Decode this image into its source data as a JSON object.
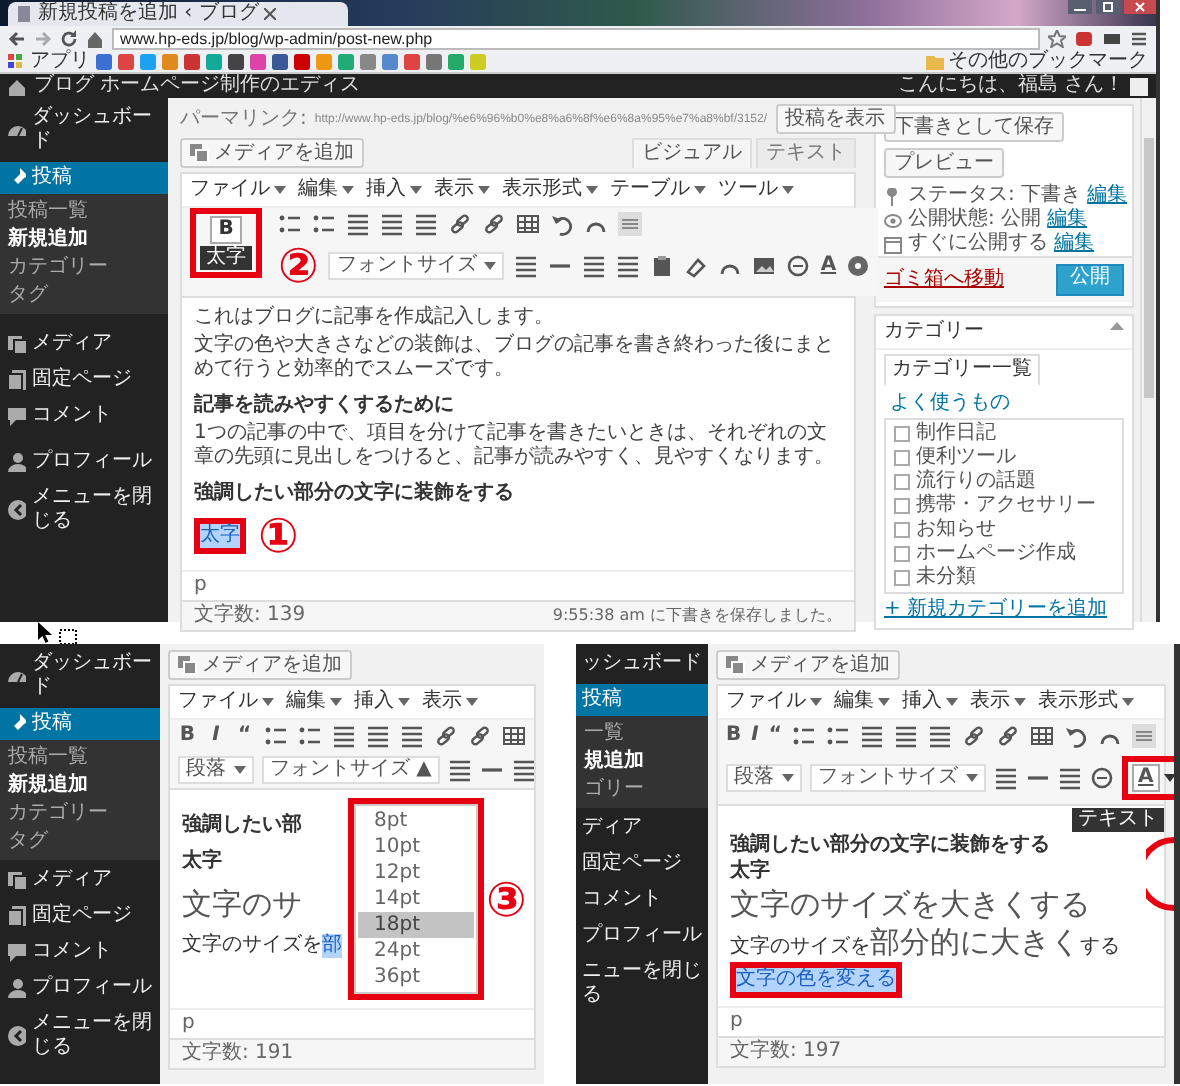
{
  "browser": {
    "tab_title": "新規投稿を追加 ‹ ブログ",
    "address": "www.hp-eds.jp/blog/wp-admin/post-new.php",
    "bookmarks": [
      "アプリ"
    ],
    "other_bookmarks": "その他のブックマーク"
  },
  "admin_bar": {
    "site_name": "ブログ ホームページ制作のエディス",
    "greeting": "こんにちは、福島 さん！"
  },
  "main_shot": {
    "sidebar": [
      {
        "label": "ダッシュボード",
        "selected": false
      },
      {
        "label": "投稿",
        "selected": true,
        "children": [
          {
            "label": "投稿一覧",
            "selected": false
          },
          {
            "label": "新規追加",
            "selected": true
          },
          {
            "label": "カテゴリー",
            "selected": false
          },
          {
            "label": "タグ",
            "selected": false
          }
        ]
      },
      {
        "label": "メディア",
        "selected": false
      },
      {
        "label": "固定ページ",
        "selected": false
      },
      {
        "label": "コメント",
        "selected": false
      },
      {
        "label": "プロフィール",
        "selected": false
      },
      {
        "label": "メニューを閉じる",
        "selected": false
      }
    ],
    "permalink": {
      "label": "パーマリンク:",
      "url": "http://www.hp-eds.jp/blog/%e6%96%b0%e8%a6%8f%e6%8a%95%e7%a8%bf/3152/",
      "button": "投稿を表示"
    },
    "media_button": "メディアを追加",
    "editor_tabs": [
      {
        "label": "ビジュアル",
        "selected": true
      },
      {
        "label": "テキスト",
        "selected": false
      }
    ],
    "menus": [
      "ファイル",
      "編集",
      "挿入",
      "表示",
      "表示形式",
      "テーブル",
      "ツール"
    ],
    "toolbar": {
      "bold": "B",
      "font_size": "フォントサイズ",
      "text_color": "A"
    },
    "tooltip": "太字",
    "content": [
      {
        "kind": "paragraph",
        "text": "これはブログに記事を作成記入します。"
      },
      {
        "kind": "paragraph",
        "text": "文字の色や大きさなどの装飾は、ブログの記事を書き終わった後にまとめて行うと効率的でスムーズです。"
      },
      {
        "kind": "heading",
        "text": "記事を読みやすくするために"
      },
      {
        "kind": "paragraph",
        "text": "1つの記事の中で、項目を分けて記事を書きたいときは、それぞれの文章の先頭に見出しをつけると、記事が読みやすく、見やすくなります。"
      },
      {
        "kind": "heading",
        "text": "強調したい部分の文字に装飾をする"
      },
      {
        "kind": "selection",
        "text": "太字"
      }
    ],
    "status": {
      "path": "p",
      "word_count": "文字数: 139",
      "autosave": "9:55:38 am に下書きを保存しました。"
    },
    "callouts": [
      "②",
      "①"
    ],
    "publish": {
      "save_draft": "下書きとして保存",
      "preview": "プレビュー",
      "rows": [
        {
          "label": "ステータス: 下書き",
          "link": "編集"
        },
        {
          "label": "公開状態: 公開",
          "link": "編集"
        },
        {
          "label": "すぐに公開する",
          "link": "編集"
        }
      ],
      "trash": "ゴミ箱へ移動",
      "publish": "公開"
    },
    "categories": {
      "title": "カテゴリー",
      "tabs": [
        {
          "label": "カテゴリー一覧",
          "selected": true
        },
        {
          "label": "よく使うもの",
          "selected": false
        }
      ],
      "items": [
        {
          "label": "制作日記",
          "checked": false
        },
        {
          "label": "便利ツール",
          "checked": false
        },
        {
          "label": "流行りの話題",
          "checked": false
        },
        {
          "label": "携帯・アクセサリー",
          "checked": false
        },
        {
          "label": "お知らせ",
          "checked": false
        },
        {
          "label": "ホームページ作成",
          "checked": false
        },
        {
          "label": "未分類",
          "checked": false
        }
      ],
      "add_link": "+ 新規カテゴリーを追加"
    }
  },
  "panels": [
    {
      "kind": "font_size_menu",
      "sidebar": [
        {
          "label": "ダッシュボード",
          "selected": false
        },
        {
          "label": "投稿",
          "selected": true,
          "children": [
            {
              "label": "投稿一覧",
              "selected": false
            },
            {
              "label": "新規追加",
              "selected": true
            },
            {
              "label": "カテゴリー",
              "selected": false
            },
            {
              "label": "タグ",
              "selected": false
            }
          ]
        },
        {
          "label": "メディア",
          "selected": false
        },
        {
          "label": "固定ページ",
          "selected": false
        },
        {
          "label": "コメント",
          "selected": false
        },
        {
          "label": "プロフィール",
          "selected": false
        },
        {
          "label": "メニューを閉じる",
          "selected": false
        }
      ],
      "media_button": "メディアを追加",
      "menus": [
        "ファイル",
        "編集",
        "挿入",
        "表示"
      ],
      "toolbar": {
        "bold": "B",
        "italic": "I",
        "quote": "“",
        "format": "段落",
        "font_size": "フォントサイズ ▲"
      },
      "font_sizes": [
        {
          "label": "8pt",
          "selected": false
        },
        {
          "label": "10pt",
          "selected": false
        },
        {
          "label": "12pt",
          "selected": false
        },
        {
          "label": "14pt",
          "selected": false
        },
        {
          "label": "18pt",
          "selected": true
        },
        {
          "label": "24pt",
          "selected": false
        },
        {
          "label": "36pt",
          "selected": false
        }
      ],
      "content": [
        {
          "kind": "heading",
          "text": "強調したい部"
        },
        {
          "kind": "bold",
          "text": "太字"
        },
        {
          "kind": "large",
          "text": "文字のサ"
        },
        {
          "kind": "mixed",
          "parts": [
            {
              "kind": "plain",
              "text": "文字のサイズを"
            },
            {
              "kind": "selection",
              "text": "部"
            }
          ]
        }
      ],
      "status": {
        "path": "p",
        "word_count": "文字数: 191"
      },
      "callout": "③"
    },
    {
      "kind": "text_color",
      "sidebar": [
        {
          "label": "ッシュボード",
          "selected": false
        },
        {
          "label": "投稿",
          "selected": true,
          "children": [
            {
              "label": "一覧",
              "selected": false
            },
            {
              "label": "規追加",
              "selected": true
            },
            {
              "label": "ゴリー",
              "selected": false
            }
          ]
        },
        {
          "label": "ディア",
          "selected": false
        },
        {
          "label": "固定ページ",
          "selected": false
        },
        {
          "label": "コメント",
          "selected": false
        },
        {
          "label": "プロフィール",
          "selected": false
        },
        {
          "label": "ニューを閉じる",
          "selected": false
        }
      ],
      "media_button": "メディアを追加",
      "menus": [
        "ファイル",
        "編集",
        "挿入",
        "表示",
        "表示形式"
      ],
      "toolbar": {
        "bold": "B",
        "italic": "I",
        "quote": "“",
        "format": "段落",
        "font_size": "フォントサイズ",
        "text_color": "A"
      },
      "tooltip": "テキスト",
      "content": [
        {
          "kind": "heading",
          "text": "強調したい部分の文字に装飾をする"
        },
        {
          "kind": "bold",
          "text": "太字"
        },
        {
          "kind": "large",
          "text": "文字のサイズを大きくする"
        },
        {
          "kind": "mixed",
          "parts": [
            {
              "kind": "plain",
              "text": "文字のサイズを"
            },
            {
              "kind": "large",
              "text": "部分的に大きく"
            },
            {
              "kind": "plain",
              "text": "する"
            }
          ]
        },
        {
          "kind": "framed_selection",
          "text": "文字の色を変える"
        }
      ],
      "status": {
        "path": "p",
        "word_count": "文字数: 197"
      }
    }
  ]
}
